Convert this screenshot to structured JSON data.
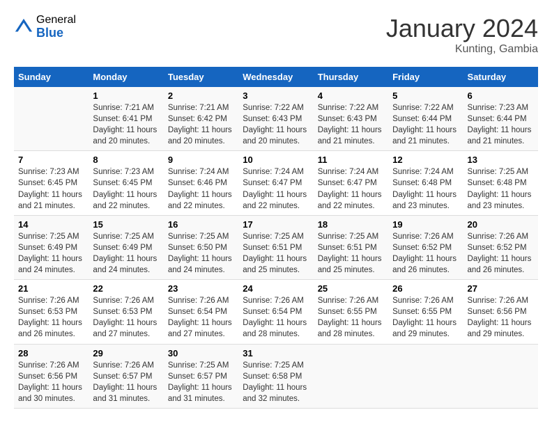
{
  "logo": {
    "general": "General",
    "blue": "Blue"
  },
  "title": "January 2024",
  "location": "Kunting, Gambia",
  "headers": [
    "Sunday",
    "Monday",
    "Tuesday",
    "Wednesday",
    "Thursday",
    "Friday",
    "Saturday"
  ],
  "weeks": [
    [
      {
        "day": "",
        "info": ""
      },
      {
        "day": "1",
        "info": "Sunrise: 7:21 AM\nSunset: 6:41 PM\nDaylight: 11 hours\nand 20 minutes."
      },
      {
        "day": "2",
        "info": "Sunrise: 7:21 AM\nSunset: 6:42 PM\nDaylight: 11 hours\nand 20 minutes."
      },
      {
        "day": "3",
        "info": "Sunrise: 7:22 AM\nSunset: 6:43 PM\nDaylight: 11 hours\nand 20 minutes."
      },
      {
        "day": "4",
        "info": "Sunrise: 7:22 AM\nSunset: 6:43 PM\nDaylight: 11 hours\nand 21 minutes."
      },
      {
        "day": "5",
        "info": "Sunrise: 7:22 AM\nSunset: 6:44 PM\nDaylight: 11 hours\nand 21 minutes."
      },
      {
        "day": "6",
        "info": "Sunrise: 7:23 AM\nSunset: 6:44 PM\nDaylight: 11 hours\nand 21 minutes."
      }
    ],
    [
      {
        "day": "7",
        "info": "Sunrise: 7:23 AM\nSunset: 6:45 PM\nDaylight: 11 hours\nand 21 minutes."
      },
      {
        "day": "8",
        "info": "Sunrise: 7:23 AM\nSunset: 6:45 PM\nDaylight: 11 hours\nand 22 minutes."
      },
      {
        "day": "9",
        "info": "Sunrise: 7:24 AM\nSunset: 6:46 PM\nDaylight: 11 hours\nand 22 minutes."
      },
      {
        "day": "10",
        "info": "Sunrise: 7:24 AM\nSunset: 6:47 PM\nDaylight: 11 hours\nand 22 minutes."
      },
      {
        "day": "11",
        "info": "Sunrise: 7:24 AM\nSunset: 6:47 PM\nDaylight: 11 hours\nand 22 minutes."
      },
      {
        "day": "12",
        "info": "Sunrise: 7:24 AM\nSunset: 6:48 PM\nDaylight: 11 hours\nand 23 minutes."
      },
      {
        "day": "13",
        "info": "Sunrise: 7:25 AM\nSunset: 6:48 PM\nDaylight: 11 hours\nand 23 minutes."
      }
    ],
    [
      {
        "day": "14",
        "info": "Sunrise: 7:25 AM\nSunset: 6:49 PM\nDaylight: 11 hours\nand 24 minutes."
      },
      {
        "day": "15",
        "info": "Sunrise: 7:25 AM\nSunset: 6:49 PM\nDaylight: 11 hours\nand 24 minutes."
      },
      {
        "day": "16",
        "info": "Sunrise: 7:25 AM\nSunset: 6:50 PM\nDaylight: 11 hours\nand 24 minutes."
      },
      {
        "day": "17",
        "info": "Sunrise: 7:25 AM\nSunset: 6:51 PM\nDaylight: 11 hours\nand 25 minutes."
      },
      {
        "day": "18",
        "info": "Sunrise: 7:25 AM\nSunset: 6:51 PM\nDaylight: 11 hours\nand 25 minutes."
      },
      {
        "day": "19",
        "info": "Sunrise: 7:26 AM\nSunset: 6:52 PM\nDaylight: 11 hours\nand 26 minutes."
      },
      {
        "day": "20",
        "info": "Sunrise: 7:26 AM\nSunset: 6:52 PM\nDaylight: 11 hours\nand 26 minutes."
      }
    ],
    [
      {
        "day": "21",
        "info": "Sunrise: 7:26 AM\nSunset: 6:53 PM\nDaylight: 11 hours\nand 26 minutes."
      },
      {
        "day": "22",
        "info": "Sunrise: 7:26 AM\nSunset: 6:53 PM\nDaylight: 11 hours\nand 27 minutes."
      },
      {
        "day": "23",
        "info": "Sunrise: 7:26 AM\nSunset: 6:54 PM\nDaylight: 11 hours\nand 27 minutes."
      },
      {
        "day": "24",
        "info": "Sunrise: 7:26 AM\nSunset: 6:54 PM\nDaylight: 11 hours\nand 28 minutes."
      },
      {
        "day": "25",
        "info": "Sunrise: 7:26 AM\nSunset: 6:55 PM\nDaylight: 11 hours\nand 28 minutes."
      },
      {
        "day": "26",
        "info": "Sunrise: 7:26 AM\nSunset: 6:55 PM\nDaylight: 11 hours\nand 29 minutes."
      },
      {
        "day": "27",
        "info": "Sunrise: 7:26 AM\nSunset: 6:56 PM\nDaylight: 11 hours\nand 29 minutes."
      }
    ],
    [
      {
        "day": "28",
        "info": "Sunrise: 7:26 AM\nSunset: 6:56 PM\nDaylight: 11 hours\nand 30 minutes."
      },
      {
        "day": "29",
        "info": "Sunrise: 7:26 AM\nSunset: 6:57 PM\nDaylight: 11 hours\nand 31 minutes."
      },
      {
        "day": "30",
        "info": "Sunrise: 7:25 AM\nSunset: 6:57 PM\nDaylight: 11 hours\nand 31 minutes."
      },
      {
        "day": "31",
        "info": "Sunrise: 7:25 AM\nSunset: 6:58 PM\nDaylight: 11 hours\nand 32 minutes."
      },
      {
        "day": "",
        "info": ""
      },
      {
        "day": "",
        "info": ""
      },
      {
        "day": "",
        "info": ""
      }
    ]
  ]
}
